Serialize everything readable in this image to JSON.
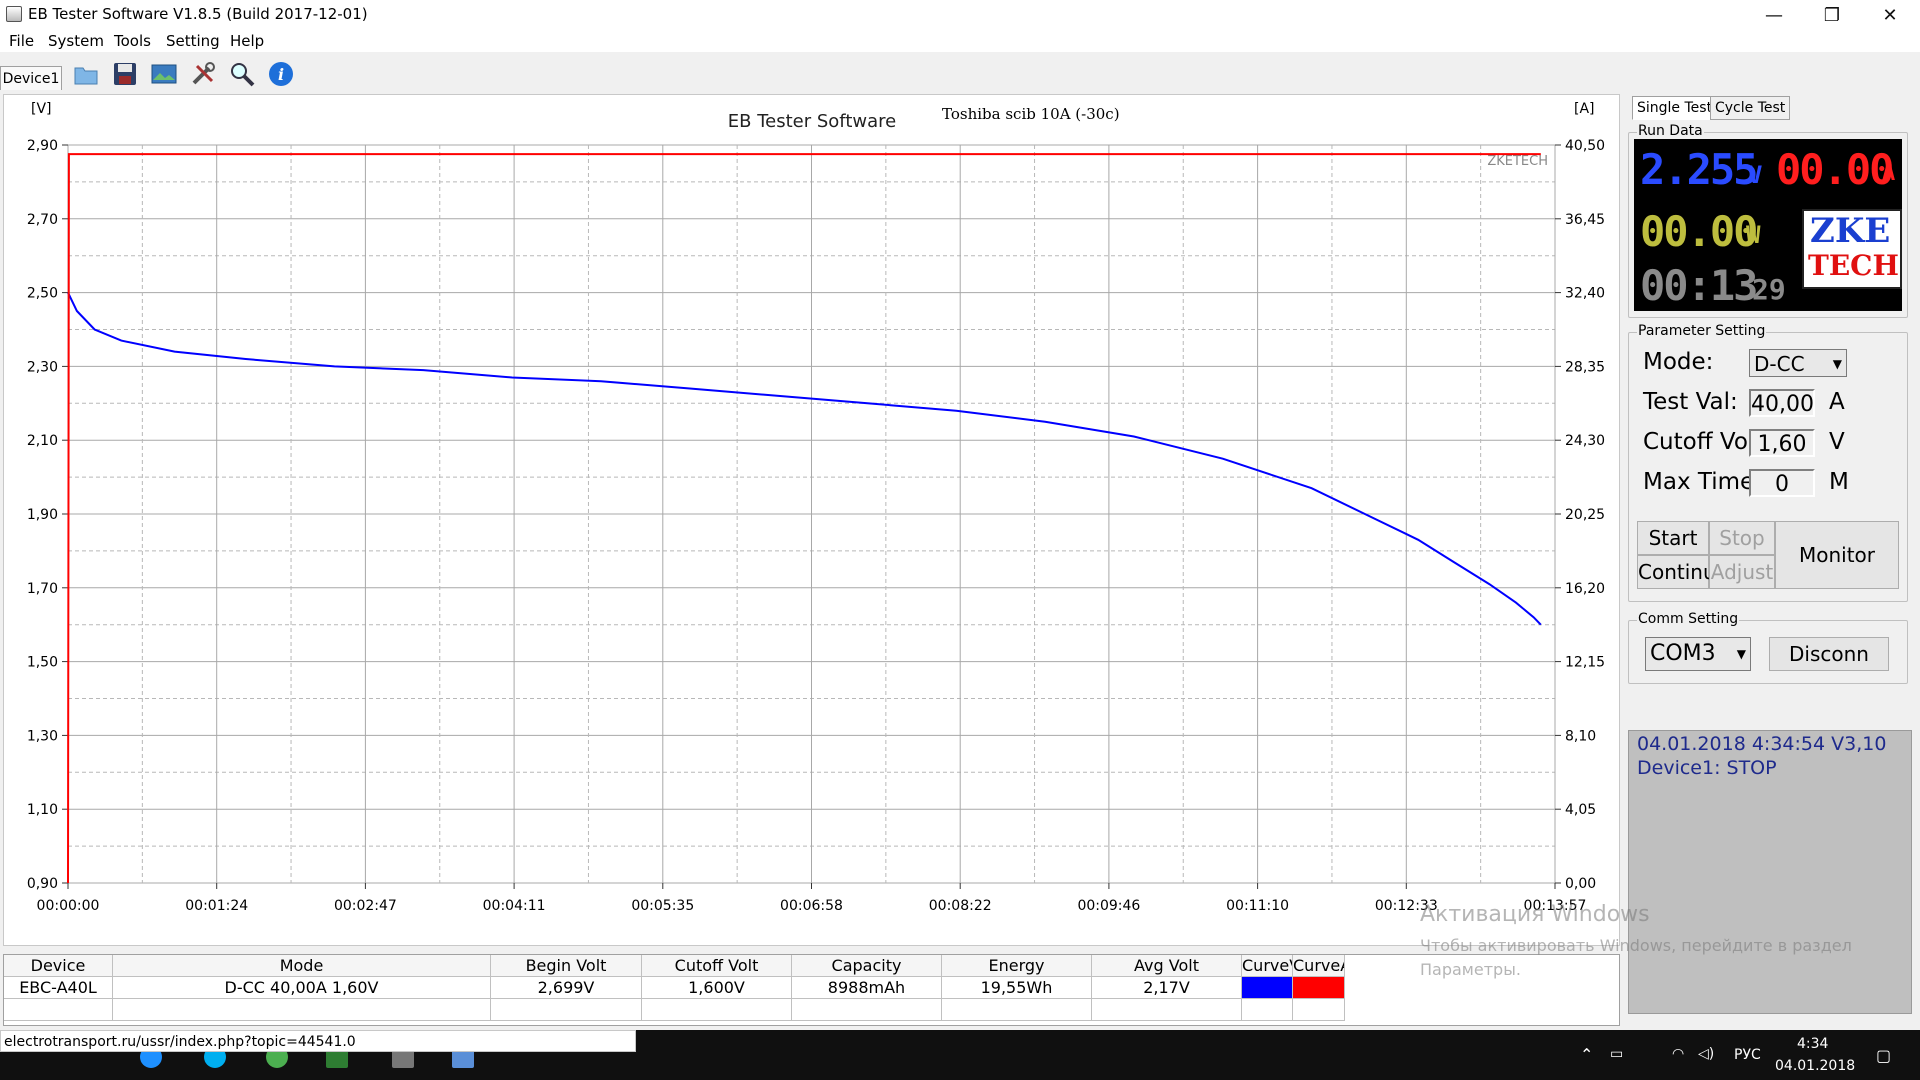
{
  "window": {
    "title": "EB Tester Software V1.8.5 (Build 2017-12-01)",
    "controls": [
      "—",
      "❐",
      "✕"
    ]
  },
  "menu": [
    "File",
    "System",
    "Tools",
    "Setting",
    "Help"
  ],
  "toolbar": {
    "device_tab": "Device1",
    "icons": [
      "folder-icon",
      "save-icon",
      "image-icon",
      "tools-icon",
      "zoom-icon",
      "info-icon"
    ]
  },
  "chart": {
    "left_unit": "[V]",
    "right_unit": "[A]",
    "title": "EB Tester Software",
    "subtitle": "Toshiba scib 10A (-30c)",
    "brand": "ZKETECH",
    "left_ticks": [
      "2,90",
      "2,70",
      "2,50",
      "2,30",
      "2,10",
      "1,90",
      "1,70",
      "1,50",
      "1,30",
      "1,10",
      "0,90"
    ],
    "right_ticks": [
      "40,50",
      "36,45",
      "32,40",
      "28,35",
      "24,30",
      "20,25",
      "16,20",
      "12,15",
      "8,10",
      "4,05",
      "0,00"
    ],
    "x_ticks": [
      "00:00:00",
      "00:01:24",
      "00:02:47",
      "00:04:11",
      "00:05:35",
      "00:06:58",
      "00:08:22",
      "00:09:46",
      "00:11:10",
      "00:12:33",
      "00:13:57"
    ]
  },
  "chart_data": {
    "type": "line",
    "x_unit": "seconds",
    "xlim": [
      0,
      837
    ],
    "ylim_left": [
      0.9,
      2.9
    ],
    "ylim_right": [
      0,
      40.5
    ],
    "grid": true,
    "series": [
      {
        "name": "CurveV",
        "axis": "left",
        "color": "#0000ff",
        "x": [
          0,
          5,
          15,
          30,
          60,
          100,
          150,
          200,
          250,
          300,
          350,
          400,
          450,
          500,
          550,
          600,
          650,
          700,
          730,
          760,
          780,
          800,
          815,
          825,
          829
        ],
        "y": [
          2.5,
          2.45,
          2.4,
          2.37,
          2.34,
          2.32,
          2.3,
          2.29,
          2.27,
          2.26,
          2.24,
          2.22,
          2.2,
          2.18,
          2.15,
          2.11,
          2.05,
          1.97,
          1.9,
          1.83,
          1.77,
          1.71,
          1.66,
          1.62,
          1.6
        ]
      },
      {
        "name": "CurveA",
        "axis": "right",
        "color": "#ff0000",
        "x": [
          0,
          0.5,
          829
        ],
        "y": [
          0,
          40.0,
          40.0
        ]
      }
    ]
  },
  "right_panel": {
    "tabs": [
      "Single Test",
      "Cycle Test"
    ],
    "run_data_title": "Run Data",
    "voltage": "2.255",
    "voltage_unit": "V",
    "current": "00.00",
    "current_unit": "A",
    "power": "00.00",
    "power_unit": "W",
    "time_hm": "00:13",
    "time_s": "29",
    "logo_line1": "ZKE",
    "logo_line2": "TECH",
    "param_title": "Parameter Setting",
    "mode_label": "Mode:",
    "mode_value": "D-CC",
    "test_val_label": "Test Val:",
    "test_val": "40,00",
    "test_val_unit": "A",
    "cutoff_label": "Cutoff Volt:",
    "cutoff_val": "1,60",
    "cutoff_unit": "V",
    "maxtime_label": "Max Time:",
    "maxtime_val": "0",
    "maxtime_unit": "M",
    "buttons": {
      "start": "Start",
      "stop": "Stop",
      "continue": "Continue",
      "adjust": "Adjust",
      "monitor": "Monitor"
    },
    "comm_title": "Comm Setting",
    "com_port": "COM3",
    "disconn": "Disconn",
    "status_line1": "04.01.2018 4:34:54  V3,10",
    "status_line2": "Device1: STOP"
  },
  "table": {
    "headers": [
      "Device",
      "Mode",
      "Begin Volt",
      "Cutoff Volt",
      "Capacity",
      "Energy",
      "Avg Volt",
      "CurveV",
      "CurveA"
    ],
    "row": [
      "EBC-A40L",
      "D-CC  40,00A  1,60V",
      "2,699V",
      "1,600V",
      "8988mAh",
      "19,55Wh",
      "2,17V",
      "",
      ""
    ],
    "curve_colors": [
      "#0000ff",
      "#ff0000"
    ]
  },
  "watermark": {
    "line1": "Активация Windows",
    "line2": "Чтобы активировать Windows, перейдите в раздел",
    "line3": "Параметры."
  },
  "url": "electrotransport.ru/ussr/index.php?topic=44541.0",
  "taskbar": {
    "lang": "РУС",
    "time": "4:34",
    "date": "04.01.2018"
  }
}
